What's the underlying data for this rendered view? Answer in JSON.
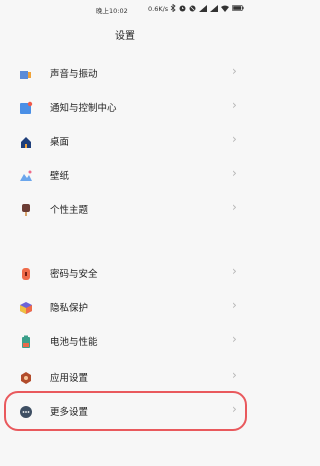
{
  "status": {
    "time": "晚上10:02",
    "speed": "0.6K/s",
    "icons": [
      "bluetooth-icon",
      "alarm-icon",
      "mute-icon",
      "signal-icon",
      "signal-icon",
      "wifi-icon",
      "battery-icon"
    ]
  },
  "header": {
    "title": "设置"
  },
  "groups": [
    {
      "items": [
        {
          "label": "声音与振动",
          "icon": "sound-icon",
          "color": "#5b8bd8"
        },
        {
          "label": "通知与控制中心",
          "icon": "notification-icon",
          "color": "#4a8fe6"
        },
        {
          "label": "桌面",
          "icon": "home-icon",
          "color": "#1f3f7a"
        },
        {
          "label": "壁纸",
          "icon": "wallpaper-icon",
          "color": "#6ba6ec"
        },
        {
          "label": "个性主题",
          "icon": "theme-icon",
          "color": "#6b3c34"
        }
      ]
    },
    {
      "items": [
        {
          "label": "密码与安全",
          "icon": "lock-icon",
          "color": "#ef6b4a"
        },
        {
          "label": "隐私保护",
          "icon": "privacy-icon",
          "color": "#6d64d8"
        },
        {
          "label": "电池与性能",
          "icon": "battery-icon",
          "color": "#3a9f8a"
        },
        {
          "label": "应用设置",
          "icon": "gear-icon",
          "color": "#b24c2b"
        },
        {
          "label": "更多设置",
          "icon": "more-icon",
          "color": "#3e4f63"
        }
      ]
    }
  ]
}
